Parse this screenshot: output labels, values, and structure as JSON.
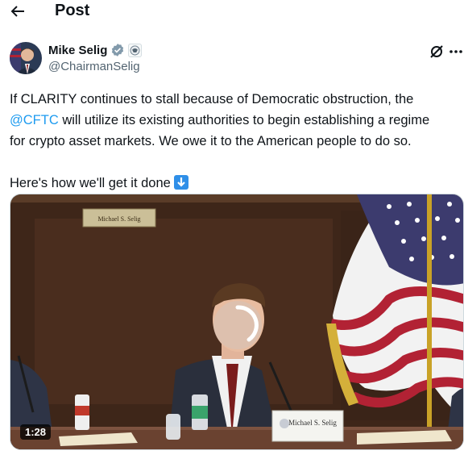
{
  "header": {
    "title": "Post",
    "back_icon": "arrow-left-icon"
  },
  "author": {
    "name": "Mike Selig",
    "handle": "@ChairmanSelig",
    "verified_icon": "verified-badge-icon",
    "affiliation_icon": "government-seal-icon"
  },
  "actions": {
    "grok_icon": "grok-icon",
    "more_icon": "more-dots-icon"
  },
  "post": {
    "line1": "If CLARITY continues to stall because of Democratic obstruction, the",
    "mention": "@CFTC",
    "line2_rest": " will utilize its existing authorities to begin establishing a regime",
    "line3": "for crypto asset markets. We owe it to the American people to do so.",
    "line4": "Here's how we'll get it done",
    "emoji": "down-arrow-emoji"
  },
  "media": {
    "duration": "1:28",
    "nameplate_back": "Michael S. Selig",
    "nameplate_front": "Michael S. Selig",
    "accent_flag_red": "#b22234",
    "accent_flag_blue": "#3c3b6e"
  }
}
